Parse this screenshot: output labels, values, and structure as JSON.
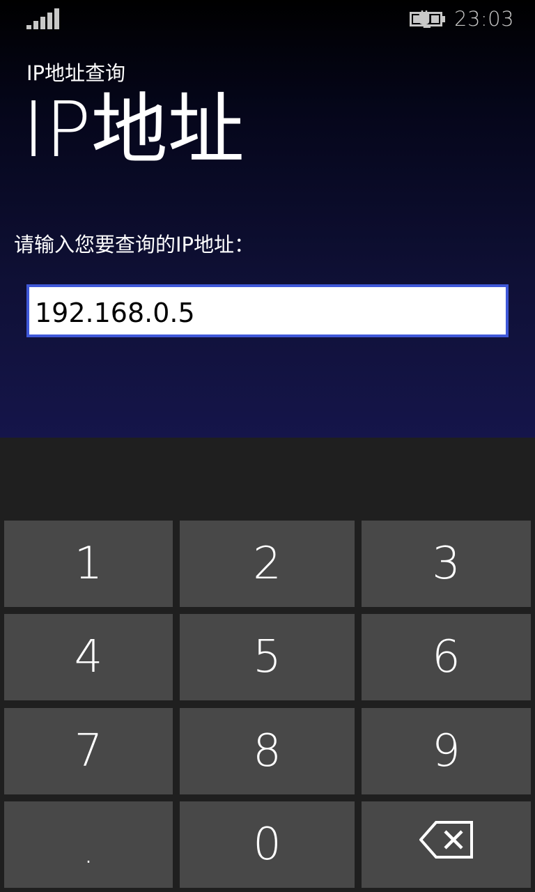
{
  "status_bar": {
    "time": "23:03",
    "signal_icon": "signal-strength-icon",
    "battery_icon": "battery-charging-icon"
  },
  "app": {
    "app_title": "IP地址查询",
    "page_title": "IP地址",
    "prompt": "请输入您要查询的IP地址：",
    "ip_input": {
      "value": "192.168.0.5",
      "placeholder": ""
    }
  },
  "keyboard": {
    "keys": [
      "1",
      "2",
      "3",
      "4",
      "5",
      "6",
      "7",
      "8",
      "9",
      ".",
      "0"
    ],
    "backspace_icon": "backspace-icon"
  },
  "colors": {
    "input_border": "#3f58d8",
    "key_background": "#484848",
    "keyboard_background": "#1f1f1f"
  }
}
